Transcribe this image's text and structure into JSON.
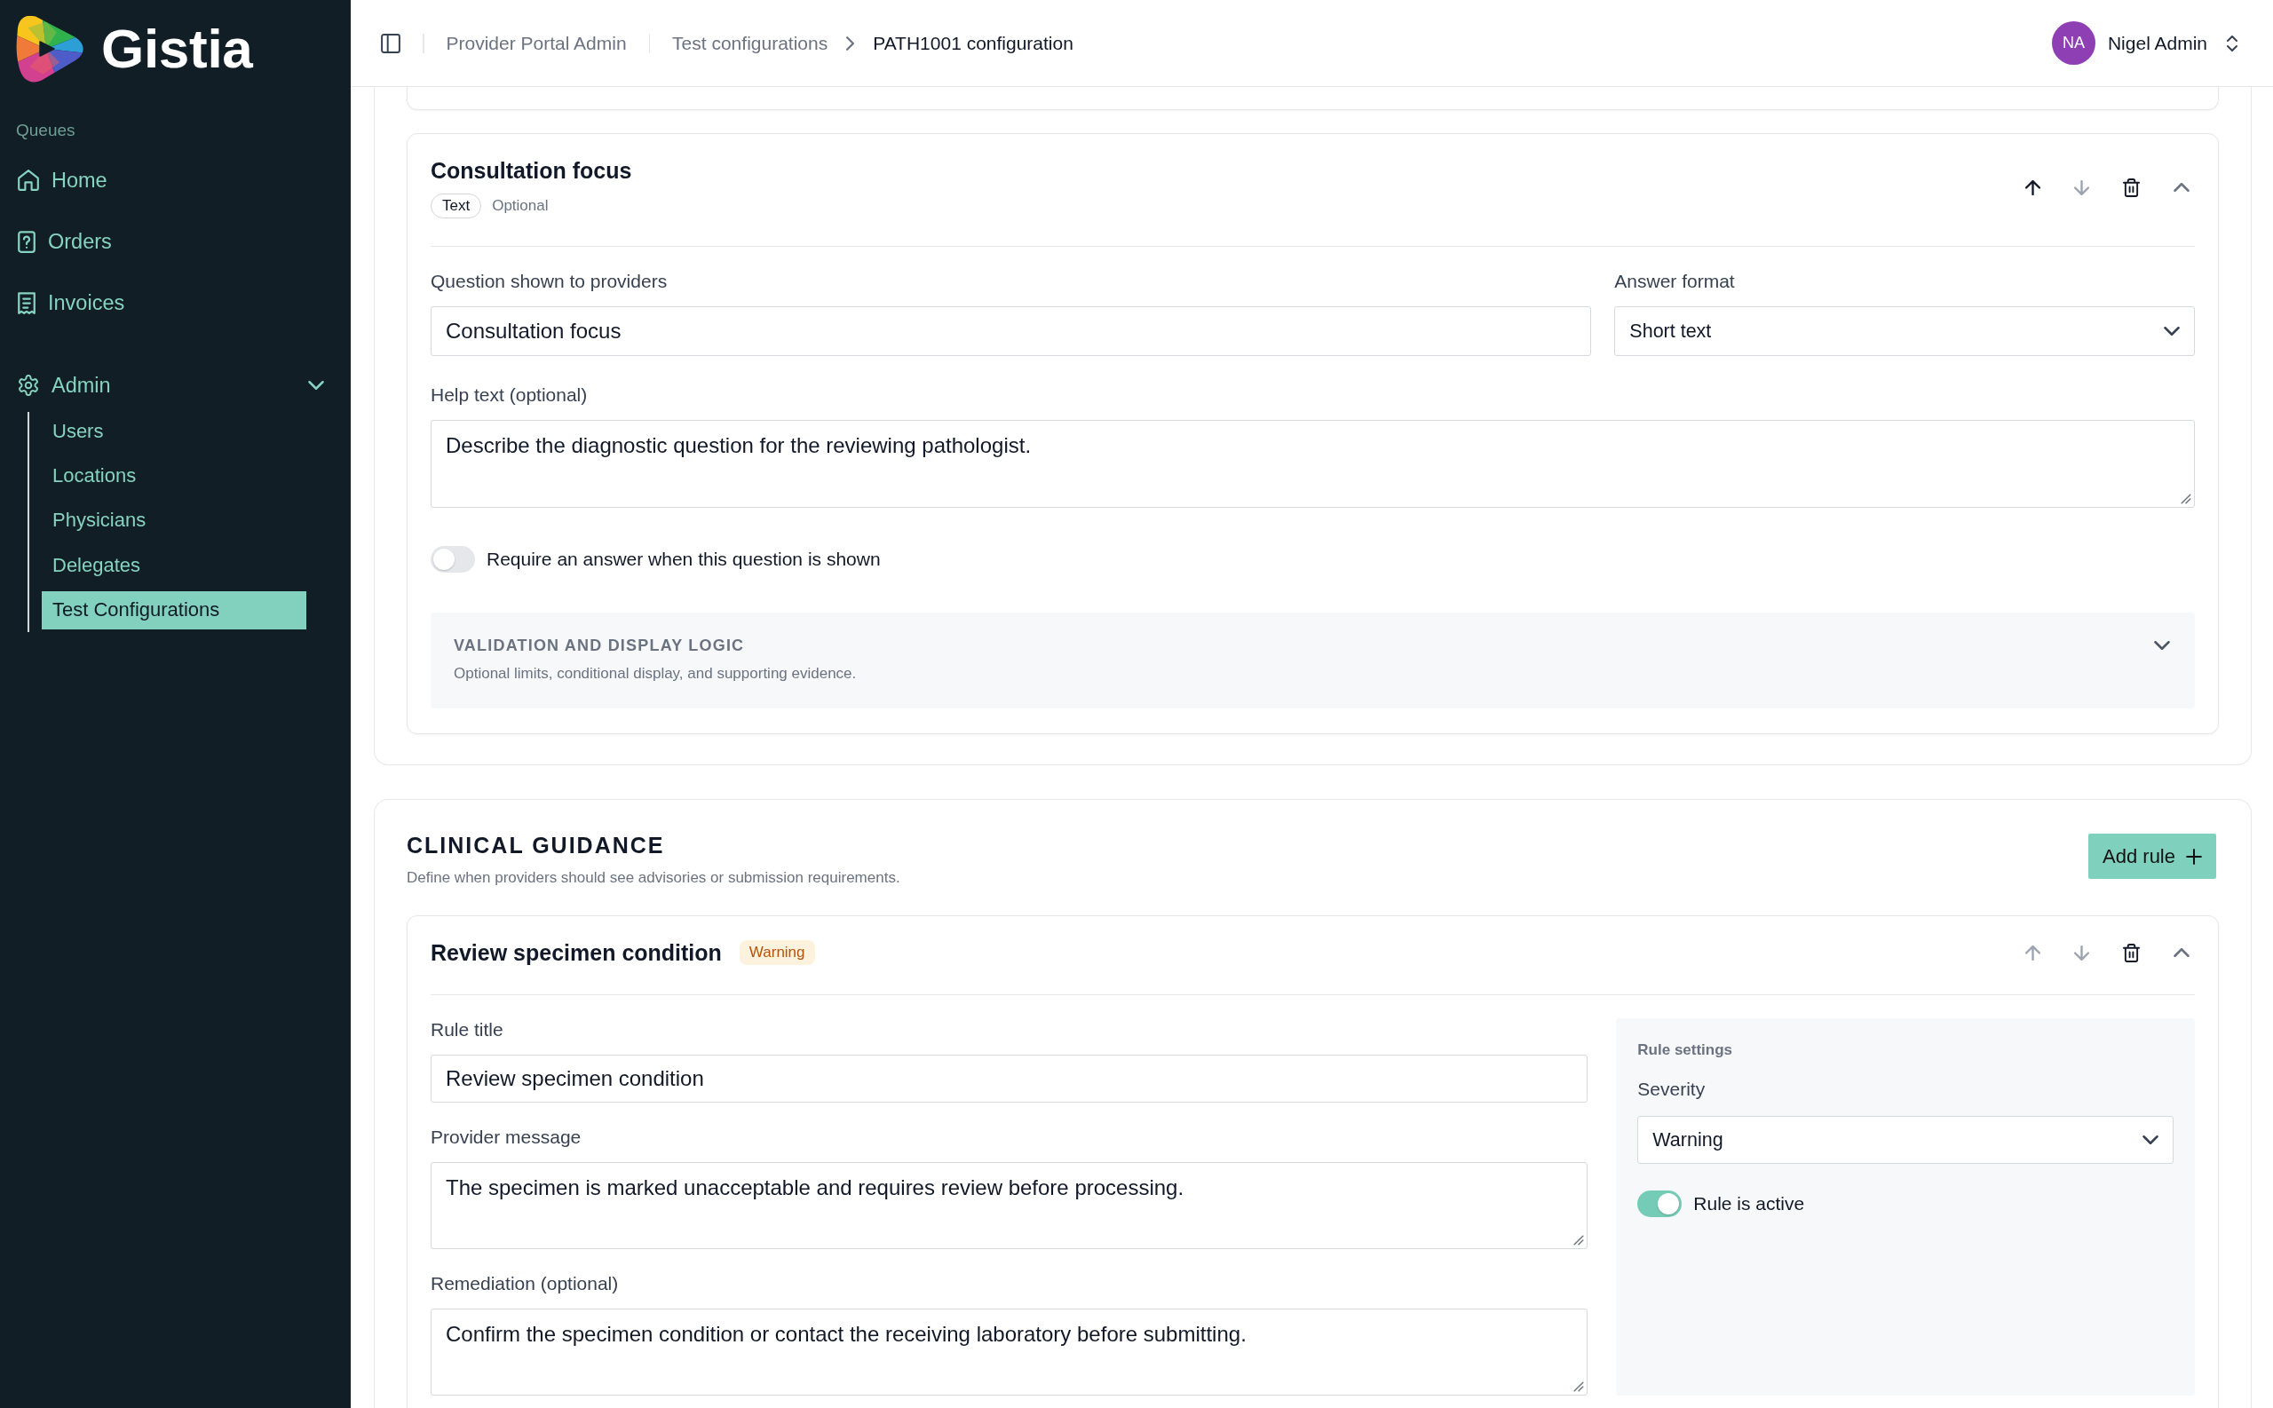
{
  "sidebar": {
    "brand": "Gistia",
    "section_label": "Queues",
    "items": [
      {
        "label": "Home",
        "selected": false
      },
      {
        "label": "Orders",
        "selected": false
      },
      {
        "label": "Invoices",
        "selected": false
      }
    ],
    "group": {
      "label": "Admin",
      "expanded": true,
      "children": [
        {
          "label": "Users",
          "selected": false
        },
        {
          "label": "Locations",
          "selected": false
        },
        {
          "label": "Physicians",
          "selected": false
        },
        {
          "label": "Delegates",
          "selected": false
        },
        {
          "label": "Test Configurations",
          "selected": true
        }
      ]
    }
  },
  "topbar": {
    "breadcrumbs": [
      {
        "label": "Provider Portal Admin",
        "kind": "root"
      },
      {
        "label": "Test configurations",
        "kind": "link"
      },
      {
        "label": "PATH1001 configuration",
        "kind": "current"
      }
    ],
    "user": {
      "initials": "NA",
      "name": "Nigel Admin"
    }
  },
  "question": {
    "title": "Consultation focus",
    "type_badge": "Text",
    "requirement": "Optional",
    "move_up_disabled": false,
    "move_down_disabled": true,
    "expanded": true,
    "question_label": "Question shown to providers",
    "question_value": "Consultation focus",
    "format_label": "Answer format",
    "format_value": "Short text",
    "help_label": "Help text (optional)",
    "help_value": "Describe the diagnostic question for the reviewing pathologist.",
    "require_toggle": {
      "label": "Require an answer when this question is shown",
      "on": false
    },
    "logic_panel": {
      "title": "VALIDATION AND DISPLAY LOGIC",
      "subtitle": "Optional limits, conditional display, and supporting evidence.",
      "expanded": false
    }
  },
  "guidance": {
    "title": "CLINICAL GUIDANCE",
    "description": "Define when providers should see advisories or submission requirements.",
    "add_button": "Add rule",
    "rules": [
      {
        "title": "Review specimen condition",
        "badge": {
          "label": "Warning",
          "kind": "warning"
        },
        "move_up_disabled": true,
        "move_down_disabled": true,
        "expanded": true,
        "title_label": "Rule title",
        "title_value": "Review specimen condition",
        "message_label": "Provider message",
        "message_value": "The specimen is marked unacceptable and requires review before processing.",
        "remediation_label": "Remediation (optional)",
        "remediation_value": "Confirm the specimen condition or contact the receiving laboratory before submitting.",
        "settings": {
          "heading": "Rule settings",
          "severity_label": "Severity",
          "severity_value": "Warning",
          "active_label": "Rule is active",
          "active": true
        }
      }
    ]
  }
}
